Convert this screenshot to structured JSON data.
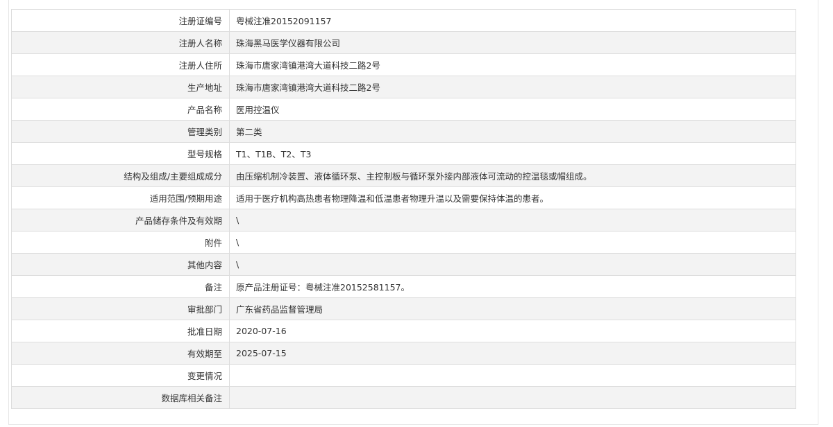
{
  "rows": [
    {
      "label": "注册证编号",
      "value": "粤械注准20152091157"
    },
    {
      "label": "注册人名称",
      "value": "珠海黑马医学仪器有限公司"
    },
    {
      "label": "注册人住所",
      "value": "珠海市唐家湾镇港湾大道科技二路2号"
    },
    {
      "label": "生产地址",
      "value": "珠海市唐家湾镇港湾大道科技二路2号"
    },
    {
      "label": "产品名称",
      "value": "医用控温仪"
    },
    {
      "label": "管理类别",
      "value": "第二类"
    },
    {
      "label": "型号规格",
      "value": "T1、T1B、T2、T3"
    },
    {
      "label": "结构及组成/主要组成成分",
      "value": "由压缩机制冷装置、液体循环泵、主控制板与循环泵外接内部液体可流动的控温毯或帽组成。"
    },
    {
      "label": "适用范围/预期用途",
      "value": "适用于医疗机构高热患者物理降温和低温患者物理升温以及需要保持体温的患者。"
    },
    {
      "label": "产品储存条件及有效期",
      "value": "\\"
    },
    {
      "label": "附件",
      "value": "\\"
    },
    {
      "label": "其他内容",
      "value": "\\"
    },
    {
      "label": "备注",
      "value": "原产品注册证号：粤械注准20152581157。"
    },
    {
      "label": "审批部门",
      "value": "广东省药品监督管理局"
    },
    {
      "label": "批准日期",
      "value": "2020-07-16"
    },
    {
      "label": "有效期至",
      "value": "2025-07-15"
    },
    {
      "label": "变更情况",
      "value": ""
    },
    {
      "label": "数据库相关备注",
      "value": ""
    }
  ]
}
